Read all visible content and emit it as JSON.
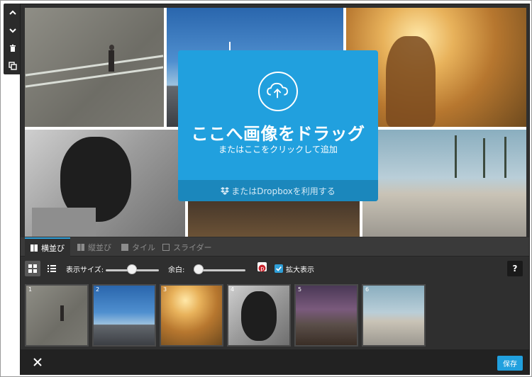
{
  "toolbar": {
    "move_up": "move-up",
    "move_down": "move-down",
    "delete": "delete",
    "duplicate": "duplicate"
  },
  "dropzone": {
    "title": "ここへ画像をドラッグ",
    "subtitle": "またはここをクリックして追加",
    "dropbox_label": "またはDropboxを利用する"
  },
  "tabs": [
    {
      "label": "横並び",
      "active": true
    },
    {
      "label": "縦並び",
      "active": false
    },
    {
      "label": "タイル",
      "active": false
    },
    {
      "label": "スライダー",
      "active": false
    }
  ],
  "options": {
    "display_size_label": "表示サイズ:",
    "display_size_value": 0.52,
    "margin_label": "余白:",
    "margin_value": 0.05,
    "zoom_label": "拡大表示",
    "zoom_checked": true,
    "help_label": "?"
  },
  "thumbnails": [
    {
      "number": "1"
    },
    {
      "number": "2"
    },
    {
      "number": "3"
    },
    {
      "number": "4"
    },
    {
      "number": "5"
    },
    {
      "number": "6"
    }
  ],
  "footer": {
    "save_label": "保存"
  },
  "colors": {
    "accent": "#21a0de",
    "panel": "#2f2f2f",
    "toolbar": "#2b2b2b"
  }
}
